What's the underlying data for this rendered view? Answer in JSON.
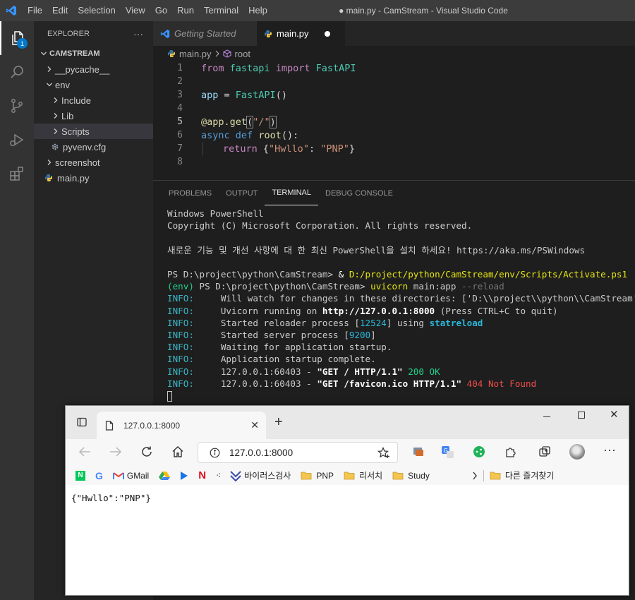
{
  "titlebar": {
    "menus": [
      "File",
      "Edit",
      "Selection",
      "View",
      "Go",
      "Run",
      "Terminal",
      "Help"
    ],
    "window_title": "● main.py - CamStream - Visual Studio Code"
  },
  "activity": {
    "explorer_badge": "1"
  },
  "explorer": {
    "header": "EXPLORER",
    "more": "···",
    "project": "CAMSTREAM",
    "items": [
      {
        "label": "__pycache__"
      },
      {
        "label": "env"
      },
      {
        "label": "Include"
      },
      {
        "label": "Lib"
      },
      {
        "label": "Scripts"
      },
      {
        "label": "pyvenv.cfg"
      },
      {
        "label": "screenshot"
      },
      {
        "label": "main.py"
      }
    ]
  },
  "tabs": {
    "getting_started": "Getting Started",
    "main": "main.py"
  },
  "breadcrumb": {
    "file": "main.py",
    "symbol": "root"
  },
  "editor": {
    "line_numbers": [
      "1",
      "2",
      "3",
      "4",
      "5",
      "6",
      "7",
      "8"
    ],
    "l1": {
      "from": "from",
      "mod": "fastapi",
      "imp": "import",
      "cls": "FastAPI"
    },
    "l3": {
      "var": "app",
      "eq": " = ",
      "fn": "FastAPI",
      "paren": "()"
    },
    "l5": {
      "at": "@",
      "var": "app",
      "dot": ".",
      "fn": "get",
      "open": "(",
      "str": "\"/\"",
      "close": ")"
    },
    "l6": {
      "async": "async",
      "def": "def",
      "fn": "root",
      "rest": "():"
    },
    "l7": {
      "ret": "return",
      "ob": " {",
      "k": "\"Hwllo\"",
      "colon": ": ",
      "v": "\"PNP\"",
      "cb": "}"
    }
  },
  "panel": {
    "tabs": [
      "PROBLEMS",
      "OUTPUT",
      "TERMINAL",
      "DEBUG CONSOLE"
    ],
    "active_tab": "TERMINAL"
  },
  "terminal": {
    "l1": "Windows PowerShell",
    "l2": "Copyright (C) Microsoft Corporation. All rights reserved.",
    "l3": "새로운 기능 및 개선 사항에 대 한 최신 PowerShell을 설치 하세요! https://aka.ms/PSWindows",
    "l4_prompt": "PS D:\\project\\python\\CamStream> ",
    "l4_amp": "& ",
    "l4_cmd": "D:/project/python/CamStream/env/Scripts/Activate.ps1",
    "l5_env": "(env) ",
    "l5_prompt": "PS D:\\project\\python\\CamStream> ",
    "l5_cmd": "uvicorn",
    "l5_arg": " main:app ",
    "l5_flag": "--reload",
    "info": "INFO:",
    "i1": "     Will watch for changes in these directories: ['D:\\\\project\\\\python\\\\CamStream']",
    "i2a": "     Uvicorn running on ",
    "i2b": "http://127.0.0.1:8000",
    "i2c": " (Press CTRL+C to quit)",
    "i3a": "     Started reloader process [",
    "i3b": "12524",
    "i3c": "] using ",
    "i3d": "statreload",
    "i4a": "     Started server process [",
    "i4b": "9200",
    "i4c": "]",
    "i5": "     Waiting for application startup.",
    "i6": "     Application startup complete.",
    "i7a": "     127.0.0.1:60403 - ",
    "i7b": "\"GET / HTTP/1.1\"",
    "i7c": " 200 OK",
    "i8a": "     127.0.0.1:60403 - ",
    "i8b": "\"GET /favicon.ico HTTP/1.1\"",
    "i8c": " 404 Not Found"
  },
  "browser": {
    "tab_title": "127.0.0.1:8000",
    "url": "127.0.0.1:8000",
    "bookmarks": [
      "GMail",
      "바이러스검사",
      "PNP",
      "리서치",
      "Study",
      "다른 즐겨찾기"
    ],
    "body": "{\"Hwllo\":\"PNP\"}"
  }
}
